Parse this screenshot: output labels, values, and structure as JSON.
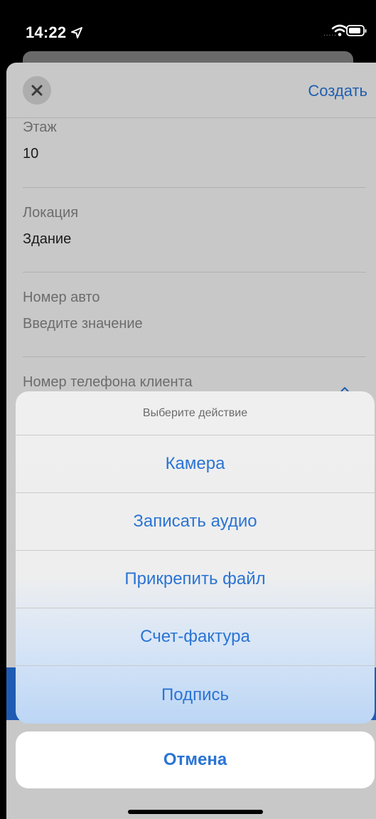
{
  "status_bar": {
    "time": "14:22",
    "signal": "....."
  },
  "header": {
    "create_label": "Создать"
  },
  "form": {
    "fields": [
      {
        "label": "Этаж",
        "value": "10"
      },
      {
        "label": "Локация",
        "value": "Здание"
      },
      {
        "label": "Номер авто",
        "placeholder": "Введите значение"
      },
      {
        "label": "Номер телефона клиента"
      }
    ]
  },
  "action_sheet": {
    "title": "Выберите действие",
    "items": [
      {
        "label": "Камера"
      },
      {
        "label": "Записать аудио"
      },
      {
        "label": "Прикрепить файл"
      },
      {
        "label": "Счет-фактура"
      },
      {
        "label": "Подпись"
      }
    ],
    "cancel_label": "Отмена"
  },
  "colors": {
    "accent": "#2a74d4",
    "status_bg": "#000000",
    "sheet_dimmed": "#c8c8c8",
    "blue_bar": "#1f5bb3"
  }
}
